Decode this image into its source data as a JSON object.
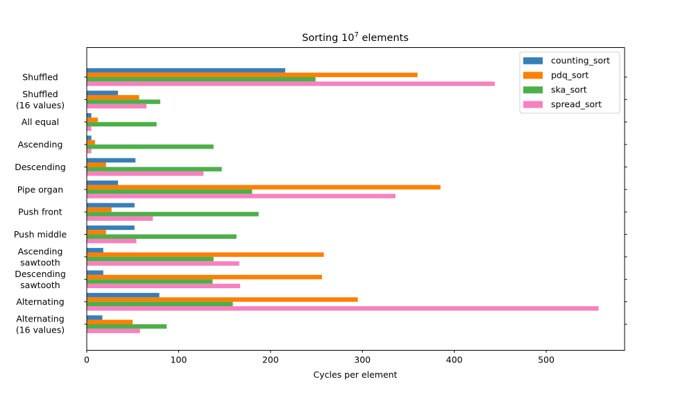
{
  "chart_data": {
    "type": "bar",
    "orientation": "horizontal",
    "title": "Sorting 10",
    "title_superscript": "7",
    "title_suffix": " elements",
    "xlabel": "Cycles per element",
    "ylabel": "",
    "xlim": [
      0,
      585
    ],
    "xticks": [
      0,
      100,
      200,
      300,
      400,
      500
    ],
    "grid": false,
    "legend_position": "top-right",
    "categories": [
      [
        "Shuffled"
      ],
      [
        "Shuffled",
        "(16 values)"
      ],
      [
        "All equal"
      ],
      [
        "Ascending"
      ],
      [
        "Descending"
      ],
      [
        "Pipe organ"
      ],
      [
        "Push front"
      ],
      [
        "Push middle"
      ],
      [
        "Ascending",
        "sawtooth"
      ],
      [
        "Descending",
        "sawtooth"
      ],
      [
        "Alternating"
      ],
      [
        "Alternating",
        "(16 values)"
      ]
    ],
    "series": [
      {
        "name": "counting_sort",
        "color": "#377eb8",
        "values": [
          216,
          34,
          5,
          5,
          53,
          34,
          52,
          52,
          18,
          18,
          79,
          17
        ]
      },
      {
        "name": "pdq_sort",
        "color": "#ff7f00",
        "values": [
          360,
          57,
          12,
          9,
          21,
          385,
          27,
          21,
          258,
          256,
          295,
          50
        ]
      },
      {
        "name": "ska_sort",
        "color": "#4daf4a",
        "values": [
          249,
          80,
          76,
          138,
          147,
          180,
          187,
          163,
          138,
          137,
          159,
          87
        ]
      },
      {
        "name": "spread_sort",
        "color": "#f781bf",
        "values": [
          444,
          65,
          5,
          5,
          127,
          336,
          72,
          54,
          166,
          167,
          557,
          58
        ]
      }
    ]
  }
}
